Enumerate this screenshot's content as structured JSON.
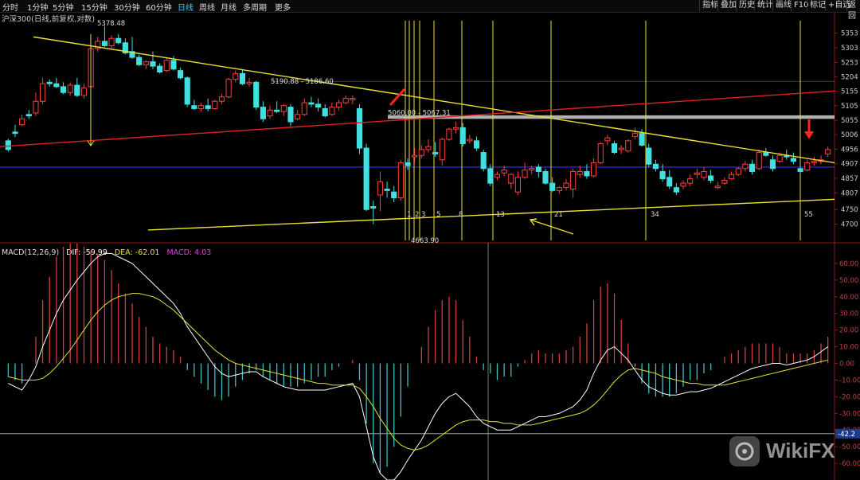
{
  "toolbar": {
    "tabs": [
      "分时",
      "1分钟",
      "5分钟",
      "15分钟",
      "30分钟",
      "60分钟",
      "日线",
      "周线",
      "月线",
      "多周期",
      "更多"
    ],
    "active_tab": "日线",
    "right_buttons": [
      "指标",
      "叠加",
      "历史",
      "统计",
      "画线",
      "F10",
      "标记",
      "+自选",
      "返回"
    ]
  },
  "symbol_label": "沪深300(日线,前复权,对数)",
  "macd_label": {
    "name": "MACD(12,26,9)",
    "dif": "DIF: -59.99",
    "dea": "DEA: -62.01",
    "macd": "MACD: 4.03"
  },
  "colors": {
    "up": "#ff4040",
    "down": "#40e0e0",
    "trend_yellow": "#e8e030",
    "trend_red": "#e02020",
    "blue_line": "#3030ff",
    "grey_band": "#b0b0b0",
    "dif": "#ffffff",
    "dea": "#e8e030"
  },
  "annotations": {
    "high_label": "5378.48",
    "low_label": "4663.90",
    "range_label_1": "5190.88 - 5186.60",
    "range_label_2": "5060.00 - 5067.31",
    "fib_labels": [
      "1",
      "2",
      "3",
      "5",
      "8",
      "13",
      "21",
      "34",
      "55"
    ],
    "macd_right_value": "-42.2",
    "watermark": "WikiFX"
  },
  "chart_data": [
    {
      "type": "candlestick",
      "title": "沪深300(日线,前复权,对数)",
      "y_ticks": [
        5353,
        5303,
        5253,
        5204,
        5155,
        5105,
        5055,
        5006,
        4956,
        4907,
        4857,
        4807,
        4750,
        4700
      ],
      "ylim": [
        4650,
        5390
      ],
      "candles": [
        [
          4985,
          4992,
          4955,
          4948
        ],
        [
          5015,
          5040,
          5010,
          4998
        ],
        [
          5040,
          5075,
          5060,
          5035
        ],
        [
          5075,
          5090,
          5070,
          5060
        ],
        [
          5080,
          5150,
          5120,
          5070
        ],
        [
          5120,
          5200,
          5180,
          5110
        ],
        [
          5185,
          5195,
          5180,
          5170
        ],
        [
          5180,
          5200,
          5170,
          5165
        ],
        [
          5170,
          5185,
          5150,
          5145
        ],
        [
          5150,
          5185,
          5175,
          5140
        ],
        [
          5175,
          5200,
          5140,
          5135
        ],
        [
          5140,
          5180,
          5165,
          5130
        ],
        [
          5170,
          5310,
          5300,
          5165
        ],
        [
          5300,
          5340,
          5325,
          5290
        ],
        [
          5325,
          5378,
          5310,
          5305
        ],
        [
          5310,
          5345,
          5335,
          5300
        ],
        [
          5335,
          5350,
          5320,
          5315
        ],
        [
          5320,
          5335,
          5285,
          5280
        ],
        [
          5290,
          5340,
          5270,
          5265
        ],
        [
          5270,
          5280,
          5245,
          5240
        ],
        [
          5245,
          5260,
          5255,
          5230
        ],
        [
          5255,
          5290,
          5240,
          5230
        ],
        [
          5240,
          5250,
          5220,
          5215
        ],
        [
          5225,
          5270,
          5260,
          5220
        ],
        [
          5260,
          5275,
          5230,
          5225
        ],
        [
          5225,
          5235,
          5200,
          5195
        ],
        [
          5200,
          5205,
          5110,
          5100
        ],
        [
          5105,
          5125,
          5095,
          5090
        ],
        [
          5095,
          5115,
          5105,
          5085
        ],
        [
          5105,
          5130,
          5095,
          5085
        ],
        [
          5095,
          5125,
          5120,
          5090
        ],
        [
          5120,
          5145,
          5135,
          5110
        ],
        [
          5135,
          5200,
          5195,
          5130
        ],
        [
          5195,
          5225,
          5215,
          5185
        ],
        [
          5215,
          5230,
          5180,
          5175
        ],
        [
          5180,
          5200,
          5185,
          5170
        ],
        [
          5185,
          5190,
          5100,
          5090
        ],
        [
          5100,
          5120,
          5060,
          5050
        ],
        [
          5070,
          5105,
          5090,
          5060
        ],
        [
          5090,
          5120,
          5085,
          5080
        ],
        [
          5085,
          5110,
          5105,
          5070
        ],
        [
          5100,
          5110,
          5050,
          5035
        ],
        [
          5060,
          5090,
          5075,
          5055
        ],
        [
          5075,
          5130,
          5115,
          5070
        ],
        [
          5115,
          5135,
          5110,
          5100
        ],
        [
          5110,
          5130,
          5100,
          5085
        ],
        [
          5095,
          5110,
          5070,
          5065
        ],
        [
          5075,
          5115,
          5100,
          5070
        ],
        [
          5100,
          5125,
          5115,
          5090
        ],
        [
          5115,
          5140,
          5130,
          5110
        ],
        [
          5125,
          5140,
          5130,
          5110
        ],
        [
          5095,
          5110,
          4960,
          4940
        ],
        [
          4960,
          4975,
          4750,
          4745
        ],
        [
          4760,
          4780,
          4755,
          4700
        ],
        [
          4800,
          4880,
          4845,
          4745
        ],
        [
          4820,
          4845,
          4815,
          4790
        ],
        [
          4810,
          4830,
          4790,
          4775
        ],
        [
          4790,
          4920,
          4910,
          4780
        ],
        [
          4910,
          4925,
          4900,
          4885
        ],
        [
          4930,
          4960,
          4935,
          4910
        ],
        [
          4935,
          4970,
          4955,
          4925
        ],
        [
          4955,
          4990,
          4965,
          4945
        ],
        [
          4945,
          4980,
          4940,
          4930
        ],
        [
          4920,
          4995,
          4990,
          4900
        ],
        [
          4990,
          5030,
          5025,
          4985
        ],
        [
          5025,
          5050,
          5030,
          5010
        ],
        [
          5030,
          5045,
          4975,
          4965
        ],
        [
          4985,
          5005,
          4990,
          4975
        ],
        [
          4985,
          5000,
          4960,
          4950
        ],
        [
          4945,
          4955,
          4890,
          4880
        ],
        [
          4890,
          4905,
          4840,
          4830
        ],
        [
          4860,
          4880,
          4870,
          4850
        ],
        [
          4875,
          4900,
          4885,
          4865
        ],
        [
          4840,
          4875,
          4870,
          4820
        ],
        [
          4810,
          4880,
          4860,
          4800
        ],
        [
          4860,
          4910,
          4885,
          4855
        ],
        [
          4885,
          4900,
          4890,
          4870
        ],
        [
          4895,
          4905,
          4880,
          4860
        ],
        [
          4880,
          4890,
          4840,
          4835
        ],
        [
          4840,
          4860,
          4815,
          4810
        ],
        [
          4815,
          4830,
          4825,
          4805
        ],
        [
          4825,
          4855,
          4840,
          4815
        ],
        [
          4820,
          4890,
          4880,
          4790
        ],
        [
          4870,
          4900,
          4880,
          4860
        ],
        [
          4880,
          4905,
          4865,
          4855
        ],
        [
          4865,
          4925,
          4910,
          4860
        ],
        [
          4910,
          4980,
          4975,
          4905
        ],
        [
          4985,
          5005,
          4995,
          4970
        ],
        [
          4975,
          4985,
          4945,
          4940
        ],
        [
          4955,
          4970,
          4960,
          4940
        ],
        [
          4950,
          4990,
          4985,
          4945
        ],
        [
          5000,
          5030,
          5010,
          4990
        ],
        [
          5010,
          5025,
          4970,
          4965
        ],
        [
          4960,
          4975,
          4905,
          4895
        ],
        [
          4905,
          4920,
          4890,
          4880
        ],
        [
          4880,
          4905,
          4855,
          4845
        ],
        [
          4860,
          4885,
          4830,
          4820
        ],
        [
          4825,
          4840,
          4810,
          4800
        ],
        [
          4830,
          4850,
          4840,
          4820
        ],
        [
          4840,
          4870,
          4855,
          4830
        ],
        [
          4870,
          4890,
          4875,
          4855
        ],
        [
          4860,
          4895,
          4880,
          4850
        ],
        [
          4865,
          4885,
          4850,
          4840
        ],
        [
          4825,
          4845,
          4830,
          4820
        ],
        [
          4840,
          4860,
          4850,
          4835
        ],
        [
          4855,
          4880,
          4870,
          4850
        ],
        [
          4870,
          4895,
          4890,
          4865
        ],
        [
          4890,
          4915,
          4905,
          4880
        ],
        [
          4905,
          4920,
          4880,
          4870
        ],
        [
          4890,
          4955,
          4945,
          4885
        ],
        [
          4945,
          4960,
          4935,
          4930
        ],
        [
          4920,
          4935,
          4890,
          4880
        ],
        [
          4915,
          4945,
          4935,
          4910
        ],
        [
          4935,
          4955,
          4930,
          4920
        ],
        [
          4925,
          4945,
          4915,
          4905
        ],
        [
          4890,
          4905,
          4880,
          4870
        ],
        [
          4885,
          4920,
          4910,
          4880
        ],
        [
          4910,
          4930,
          4915,
          4900
        ],
        [
          4915,
          4935,
          4920,
          4905
        ],
        [
          4940,
          4965,
          4955,
          4930
        ]
      ]
    },
    {
      "type": "macd",
      "y_ticks": [
        60,
        50,
        40,
        30,
        20,
        10,
        0,
        -10,
        -20,
        -30,
        -40,
        -50,
        -60
      ],
      "ylim": [
        -70,
        70
      ],
      "dif": [
        -12,
        -14,
        -16,
        -10,
        -2,
        10,
        20,
        30,
        38,
        44,
        50,
        55,
        60,
        64,
        66,
        66,
        64,
        62,
        60,
        56,
        52,
        48,
        44,
        40,
        36,
        30,
        22,
        16,
        10,
        4,
        -2,
        -6,
        -8,
        -7,
        -6,
        -5,
        -5,
        -8,
        -10,
        -12,
        -14,
        -15,
        -16,
        -16,
        -16,
        -16,
        -16,
        -15,
        -14,
        -13,
        -12,
        -20,
        -38,
        -56,
        -66,
        -70,
        -70,
        -65,
        -58,
        -52,
        -46,
        -38,
        -30,
        -24,
        -20,
        -18,
        -22,
        -26,
        -32,
        -36,
        -38,
        -40,
        -40,
        -40,
        -38,
        -36,
        -34,
        -32,
        -32,
        -31,
        -30,
        -28,
        -26,
        -22,
        -16,
        -6,
        2,
        8,
        10,
        6,
        2,
        -4,
        -10,
        -14,
        -16,
        -18,
        -19,
        -19,
        -18,
        -17,
        -17,
        -16,
        -15,
        -13,
        -11,
        -9,
        -7,
        -5,
        -3,
        -2,
        -1,
        0,
        0,
        -1,
        0,
        1,
        2,
        4,
        7,
        10
      ],
      "dea": [
        -8,
        -9,
        -10,
        -10,
        -10,
        -9,
        -6,
        -2,
        3,
        8,
        14,
        20,
        26,
        31,
        35,
        38,
        40,
        41,
        42,
        42,
        41,
        40,
        38,
        35,
        32,
        28,
        24,
        20,
        16,
        12,
        8,
        5,
        2,
        0,
        -1,
        -2,
        -3,
        -4,
        -5,
        -6,
        -7,
        -8,
        -9,
        -10,
        -11,
        -12,
        -12,
        -13,
        -13,
        -13,
        -13,
        -15,
        -20,
        -26,
        -33,
        -39,
        -45,
        -49,
        -51,
        -52,
        -51,
        -49,
        -46,
        -43,
        -40,
        -37,
        -35,
        -34,
        -34,
        -34,
        -35,
        -35,
        -36,
        -36,
        -37,
        -37,
        -37,
        -36,
        -35,
        -34,
        -33,
        -32,
        -31,
        -30,
        -28,
        -25,
        -21,
        -16,
        -11,
        -7,
        -4,
        -3,
        -4,
        -5,
        -6,
        -8,
        -9,
        -10,
        -11,
        -12,
        -12,
        -13,
        -13,
        -13,
        -13,
        -12,
        -11,
        -10,
        -9,
        -8,
        -7,
        -6,
        -5,
        -4,
        -3,
        -2,
        -1,
        0,
        1,
        2
      ]
    }
  ]
}
